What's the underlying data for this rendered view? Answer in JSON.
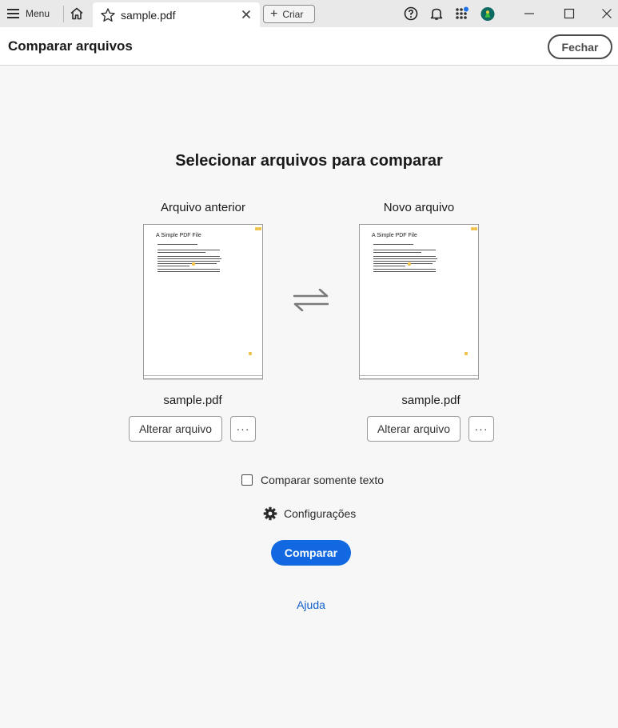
{
  "tabbar": {
    "menu_label": "Menu",
    "tab_title": "sample.pdf",
    "create_label": "Criar",
    "icons": [
      "hamburger-menu-icon",
      "home-icon",
      "star-icon",
      "close-icon",
      "plus-icon",
      "help-icon",
      "bell-icon",
      "apps-icon",
      "avatar-icon",
      "minimize-icon",
      "maximize-icon",
      "window-close-icon"
    ]
  },
  "header": {
    "title": "Comparar arquivos",
    "close_label": "Fechar"
  },
  "main": {
    "title": "Selecionar arquivos para comparar",
    "old_file": {
      "label": "Arquivo anterior",
      "thumbnail_title": "A Simple PDF File",
      "file_name": "sample.pdf",
      "change_label": "Alterar arquivo",
      "more_label": "···"
    },
    "new_file": {
      "label": "Novo arquivo",
      "thumbnail_title": "A Simple PDF File",
      "file_name": "sample.pdf",
      "change_label": "Alterar arquivo",
      "more_label": "···"
    },
    "text_only_label": "Comparar somente texto",
    "text_only_checked": false,
    "settings_label": "Configurações",
    "compare_label": "Comparar",
    "help_label": "Ajuda"
  },
  "colors": {
    "accent": "#1168e0",
    "link": "#1160cc",
    "background": "#f7f7f7",
    "tabbar": "#e9e9e9"
  }
}
